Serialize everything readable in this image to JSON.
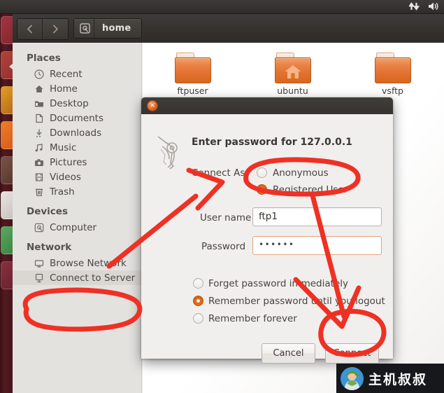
{
  "top_panel": {
    "indicators": [
      "network-updown-icon",
      "volume-icon"
    ]
  },
  "launcher": {
    "name": "unity-launcher",
    "items": [
      {
        "name": "launcher-item-dash",
        "color": "#8e2a33"
      },
      {
        "name": "launcher-item-files",
        "color": "#a33a33"
      },
      {
        "name": "launcher-item-firefox",
        "color": "#c78a1c"
      },
      {
        "name": "launcher-item-libreoffice",
        "color": "#e0651d"
      },
      {
        "name": "launcher-item-software-center",
        "color": "#5b3a2e"
      },
      {
        "name": "launcher-item-settings",
        "color": "#d6d2cd"
      },
      {
        "name": "launcher-item-terminal",
        "color": "#3f8c4a"
      },
      {
        "name": "launcher-item-trash",
        "color": "#6b2730"
      }
    ]
  },
  "toolbar": {
    "back_label": "‹",
    "forward_label": "›",
    "breadcrumb_icon": "computer-disk-icon",
    "breadcrumb_label": "home"
  },
  "sidebar": {
    "sections": [
      {
        "title": "Places",
        "items": [
          {
            "label": "Recent",
            "icon": "clock-icon",
            "active": false
          },
          {
            "label": "Home",
            "icon": "home-icon",
            "active": false
          },
          {
            "label": "Desktop",
            "icon": "desktop-folder-icon",
            "active": false
          },
          {
            "label": "Documents",
            "icon": "document-icon",
            "active": false
          },
          {
            "label": "Downloads",
            "icon": "download-arrow-icon",
            "active": false
          },
          {
            "label": "Music",
            "icon": "music-note-icon",
            "active": false
          },
          {
            "label": "Pictures",
            "icon": "camera-icon",
            "active": false
          },
          {
            "label": "Videos",
            "icon": "film-icon",
            "active": false
          },
          {
            "label": "Trash",
            "icon": "trash-icon",
            "active": false
          }
        ]
      },
      {
        "title": "Devices",
        "items": [
          {
            "label": "Computer",
            "icon": "computer-disk-icon",
            "active": false
          }
        ]
      },
      {
        "title": "Network",
        "items": [
          {
            "label": "Browse Network",
            "icon": "network-icon",
            "active": false
          },
          {
            "label": "Connect to Server",
            "icon": "server-icon",
            "active": true
          }
        ]
      }
    ]
  },
  "files": [
    {
      "label": "ftpuser",
      "type": "folder"
    },
    {
      "label": "ubuntu",
      "type": "home-folder"
    },
    {
      "label": "vsftp",
      "type": "folder"
    }
  ],
  "dialog": {
    "close_label": "×",
    "icon": "keyring-keys-icon",
    "heading": "Enter password for 127.0.0.1",
    "connect_as_label": "Connect As",
    "connect_as_options": [
      {
        "label": "Anonymous",
        "selected": false
      },
      {
        "label": "Registered User",
        "selected": true
      }
    ],
    "username_label": "User name",
    "username_value": "ftp1",
    "password_label": "Password",
    "password_value": "••••••",
    "remember_options": [
      {
        "label": "Forget password immediately",
        "selected": false
      },
      {
        "label": "Remember password until you logout",
        "selected": true
      },
      {
        "label": "Remember forever",
        "selected": false
      }
    ],
    "cancel_label": "Cancel",
    "connect_label": "Connect"
  },
  "annotations": {
    "color": "#ee3124",
    "marks": [
      {
        "name": "ellipse-connect-to-server",
        "shape": "ellipse"
      },
      {
        "name": "arrow-to-registered-user",
        "shape": "arrow"
      },
      {
        "name": "ellipse-registered-user",
        "shape": "ellipse"
      },
      {
        "name": "arrow-to-connect-button",
        "shape": "arrow"
      },
      {
        "name": "ellipse-connect-button",
        "shape": "ellipse"
      }
    ]
  },
  "watermark": {
    "text": "主机叔叔",
    "avatar": "person-avatar-icon"
  }
}
